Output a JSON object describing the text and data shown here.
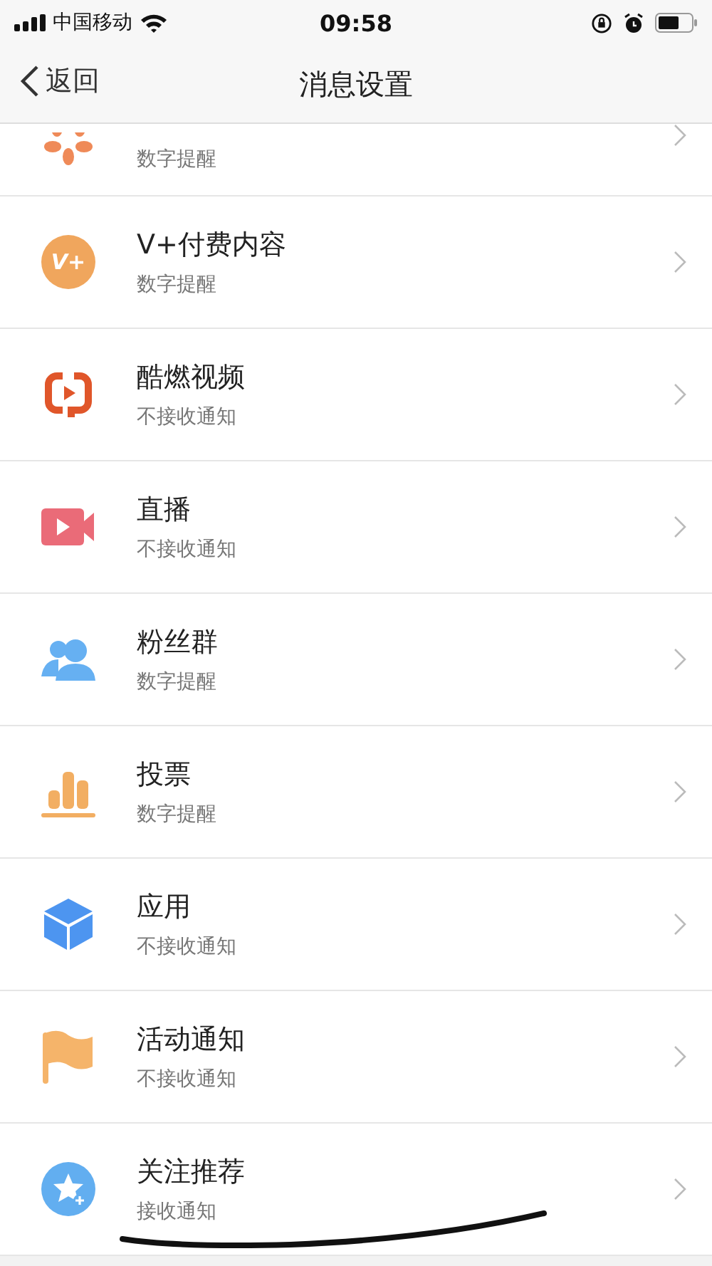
{
  "status_bar": {
    "carrier": "中国移动",
    "time": "09:58"
  },
  "nav": {
    "back": "返回",
    "title": "消息设置"
  },
  "rows": [
    {
      "cut_top": true,
      "subtitle": "数字提醒"
    },
    {
      "icon_text": "V+",
      "title": "V+付费内容",
      "subtitle": "数字提醒"
    },
    {
      "title": "酷燃视频",
      "subtitle": "不接收通知"
    },
    {
      "title": "直播",
      "subtitle": "不接收通知"
    },
    {
      "title": "粉丝群",
      "subtitle": "数字提醒"
    },
    {
      "title": "投票",
      "subtitle": "数字提醒"
    },
    {
      "title": "应用",
      "subtitle": "不接收通知"
    },
    {
      "title": "活动通知",
      "subtitle": "不接收通知"
    },
    {
      "title": "关注推荐",
      "subtitle": "接收通知"
    }
  ]
}
